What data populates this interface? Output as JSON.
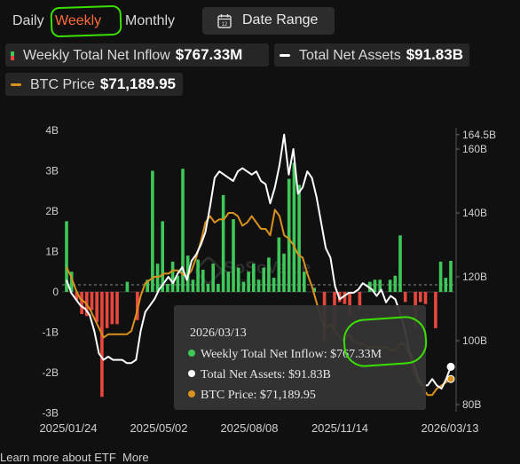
{
  "tabs": {
    "daily": "Daily",
    "weekly": "Weekly",
    "monthly": "Monthly"
  },
  "date_range": {
    "label": "Date Range",
    "icon": "calendar-icon",
    "icon_text": "12"
  },
  "stats": {
    "weekly_inflow": {
      "label": "Weekly Total Net Inflow",
      "value": "$767.33M"
    },
    "total_assets": {
      "label": "Total Net Assets",
      "value": "$91.83B"
    },
    "btc_price": {
      "label": "BTC Price",
      "value": "$71,189.95"
    }
  },
  "colors": {
    "positive": "#3ec85a",
    "negative": "#e8473d",
    "assets_line": "#ffffff",
    "btc_line": "#d9921c",
    "highlight": "#39e000",
    "active_tab": "#ff6a3a"
  },
  "chart_data": {
    "type": "bar",
    "series": [
      {
        "name": "Weekly Total Net Inflow",
        "kind": "bar",
        "axis": "left",
        "unit": "B",
        "values": [
          1.75,
          0.5,
          -0.2,
          -0.55,
          -0.6,
          -0.45,
          -0.75,
          -2.6,
          -0.9,
          -0.8,
          -0.8,
          0,
          0.25,
          0,
          -0.7,
          0,
          0.3,
          3,
          0.7,
          1.75,
          0.2,
          0.75,
          0.4,
          3.05,
          0.9,
          0.3,
          0.8,
          0.55,
          0.2,
          0.7,
          0.2,
          2.4,
          0.5,
          1.8,
          0.6,
          0.25,
          0.5,
          0.7,
          0.3,
          0.6,
          0.85,
          0.35,
          1.35,
          0.95,
          2.8,
          3.2,
          2.65,
          0.5,
          0,
          0.1,
          0,
          -1.2,
          0,
          -0.9,
          -0.25,
          -0.3,
          -0.6,
          0,
          -0.45,
          0,
          0.25,
          0.3,
          0.3,
          0,
          0.3,
          0.4,
          1.4,
          -0.25,
          0,
          -0.9,
          -0.25,
          -0.3,
          0,
          -0.9,
          0.75,
          0.35,
          0.77
        ]
      },
      {
        "name": "Total Net Assets",
        "kind": "line",
        "axis": "right",
        "unit": "B",
        "values": [
          119,
          115,
          113,
          111,
          110,
          108,
          103,
          96,
          94,
          95,
          94,
          94,
          94,
          93,
          93,
          94,
          103,
          109,
          111,
          113,
          116,
          118,
          120,
          118,
          121,
          123,
          119,
          125,
          127,
          130,
          134,
          142,
          151,
          153,
          152,
          151,
          150,
          153,
          154,
          153,
          152,
          153,
          150,
          149,
          143,
          148,
          155,
          164.5,
          152,
          160,
          146,
          148,
          153,
          151,
          145,
          137,
          129,
          126,
          117,
          113,
          114,
          115,
          115,
          116,
          118,
          117,
          116,
          114,
          116,
          112,
          114,
          113,
          109,
          104,
          97,
          93,
          88,
          86,
          86,
          88,
          86,
          85,
          88,
          91.83
        ]
      },
      {
        "name": "BTC Price",
        "kind": "line",
        "axis": "right",
        "unit": "B-scale",
        "values": [
          123,
          120,
          116,
          113,
          112,
          110,
          107,
          104,
          101,
          102,
          102,
          102,
          102,
          102,
          103,
          108,
          114,
          118,
          119,
          120,
          120,
          121,
          121,
          122,
          122,
          121,
          120,
          122,
          126,
          131,
          137,
          139,
          137,
          138,
          138,
          140,
          140,
          139,
          136,
          137,
          139,
          137,
          135,
          135,
          133,
          141,
          139,
          133,
          132,
          130,
          127,
          126,
          121,
          117,
          112,
          107,
          104,
          105,
          103,
          101,
          100,
          102,
          100,
          99,
          99,
          98,
          98,
          98,
          98,
          98,
          97,
          97,
          99,
          99,
          96,
          90,
          87,
          85,
          83,
          83,
          85,
          86,
          87,
          88
        ]
      }
    ],
    "left_axis": {
      "ticks": [
        "4B",
        "3B",
        "2B",
        "1B",
        "0",
        "-1B",
        "-2B",
        "-3B"
      ],
      "range": [
        -3,
        4
      ]
    },
    "right_axis": {
      "ticks": [
        "164.5B",
        "160B",
        "140B",
        "120B",
        "100B",
        "80B"
      ],
      "range": [
        80,
        164.5
      ]
    },
    "x_ticks": [
      "2025/01/24",
      "2025/05/02",
      "2025/08/08",
      "2025/11/14",
      "2026/03/13"
    ],
    "watermark": "SoSoValue",
    "watermark_sub": "sosovalue.com"
  },
  "tooltip": {
    "date": "2026/03/13",
    "inflow_label": "Weekly Total Net Inflow:",
    "inflow_value": "$767.33M",
    "assets_label": "Total Net Assets:",
    "assets_value": "$91.83B",
    "btc_label": "BTC Price:",
    "btc_value": "$71,189.95"
  },
  "bottom": {
    "learn_more": "Learn more about ETF",
    "more": "More"
  }
}
